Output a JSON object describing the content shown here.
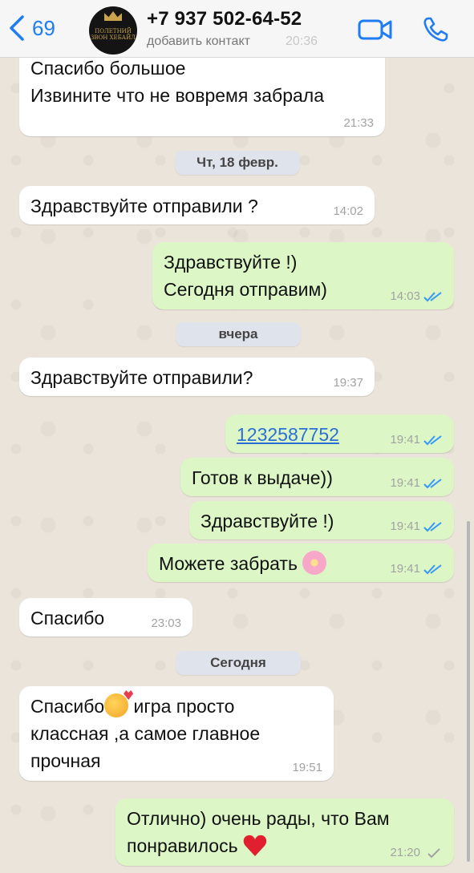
{
  "header": {
    "back_count": "69",
    "contact_name": "+7 937 502-64-52",
    "subtitle": "добавить контакт",
    "subtitle_time": "20:36",
    "avatar_text": "ПОЛЕТНИЙ ЗВОН ХЕБАЙЛ"
  },
  "messages": [
    {
      "id": "m1",
      "dir": "in",
      "lines": [
        "Спасибо большое",
        "Извините что не вовремя забрала"
      ],
      "time": "21:33"
    },
    {
      "id": "d1",
      "type": "date",
      "text": "Чт, 18 февр."
    },
    {
      "id": "m2",
      "dir": "in",
      "lines": [
        "Здравствуйте отправили ?"
      ],
      "time": "14:02"
    },
    {
      "id": "m3",
      "dir": "out",
      "lines": [
        "Здравствуйте !)",
        "Сегодня отправим)"
      ],
      "time": "14:03",
      "status": "read"
    },
    {
      "id": "d2",
      "type": "date",
      "text": "вчера"
    },
    {
      "id": "m4",
      "dir": "in",
      "lines": [
        "Здравствуйте отправили?"
      ],
      "time": "19:37"
    },
    {
      "id": "m5",
      "dir": "out",
      "lines": [
        "1232587752"
      ],
      "time": "19:41",
      "status": "read",
      "link": true
    },
    {
      "id": "m6",
      "dir": "out",
      "lines": [
        "Готов к выдаче))"
      ],
      "time": "19:41",
      "status": "read"
    },
    {
      "id": "m7",
      "dir": "out",
      "lines": [
        "Здравствуйте !)"
      ],
      "time": "19:41",
      "status": "read"
    },
    {
      "id": "m8",
      "dir": "out",
      "lines": [
        "Можете забрать"
      ],
      "emoji": "flower",
      "time": "19:41",
      "status": "read"
    },
    {
      "id": "m9",
      "dir": "in",
      "lines": [
        "Спасибо"
      ],
      "time": "23:03"
    },
    {
      "id": "d3",
      "type": "date",
      "text": "Сегодня"
    },
    {
      "id": "m10",
      "dir": "in",
      "lines": [
        "Спасибо",
        " игра просто",
        "классная ,а самое главное",
        "прочная"
      ],
      "emoji": "smiling-face-with-hearts",
      "time": "19:51"
    },
    {
      "id": "m11",
      "dir": "out",
      "lines": [
        "Отлично) очень рады, что Вам",
        "понравилось"
      ],
      "emoji": "red-heart",
      "time": "21:20",
      "status": "sent"
    }
  ],
  "colors": {
    "incoming": "#ffffff",
    "outgoing": "#dcf7c5",
    "accent": "#1f7cf4",
    "read_ticks": "#3497f9"
  }
}
